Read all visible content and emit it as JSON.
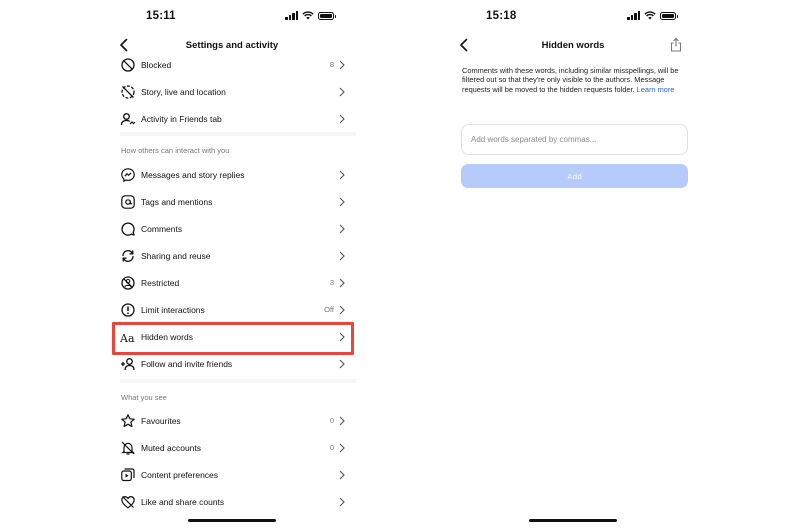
{
  "left_screen": {
    "status_time": "15:11",
    "title": "Settings and activity",
    "items_top": [
      {
        "label": "Blocked",
        "value": "8",
        "icon": "block-icon"
      },
      {
        "label": "Story, live and location",
        "value": "",
        "icon": "story-off-icon"
      },
      {
        "label": "Activity in Friends tab",
        "value": "",
        "icon": "person-activity-icon"
      }
    ],
    "section_interact": "How others can interact with you",
    "items_interact": [
      {
        "label": "Messages and story replies",
        "value": "",
        "icon": "messenger-icon"
      },
      {
        "label": "Tags and mentions",
        "value": "",
        "icon": "at-sign-icon"
      },
      {
        "label": "Comments",
        "value": "",
        "icon": "comment-icon"
      },
      {
        "label": "Sharing and reuse",
        "value": "",
        "icon": "share-reuse-icon"
      },
      {
        "label": "Restricted",
        "value": "3",
        "icon": "restricted-icon"
      },
      {
        "label": "Limit interactions",
        "value": "Off",
        "icon": "limit-icon"
      },
      {
        "label": "Hidden words",
        "value": "",
        "icon": "text-aa-icon"
      },
      {
        "label": "Follow and invite friends",
        "value": "",
        "icon": "add-person-icon"
      }
    ],
    "section_see": "What you see",
    "items_see": [
      {
        "label": "Favourites",
        "value": "0",
        "icon": "star-icon"
      },
      {
        "label": "Muted accounts",
        "value": "0",
        "icon": "bell-off-icon"
      },
      {
        "label": "Content preferences",
        "value": "",
        "icon": "content-icon"
      },
      {
        "label": "Like and share counts",
        "value": "",
        "icon": "heart-off-icon"
      }
    ]
  },
  "right_screen": {
    "status_time": "15:18",
    "title": "Hidden words",
    "description": "Comments with these words, including similar misspellings, will be filtered out so that they're only visible to the authors. Message requests will be moved to the hidden requests folder.",
    "learn_more": "Learn more",
    "input_placeholder": "Add words separated by commas...",
    "add_button": "Add"
  },
  "colors": {
    "highlight": "#e8453c",
    "link": "#2f63d4",
    "add_button_disabled": "#b7cbfb"
  }
}
